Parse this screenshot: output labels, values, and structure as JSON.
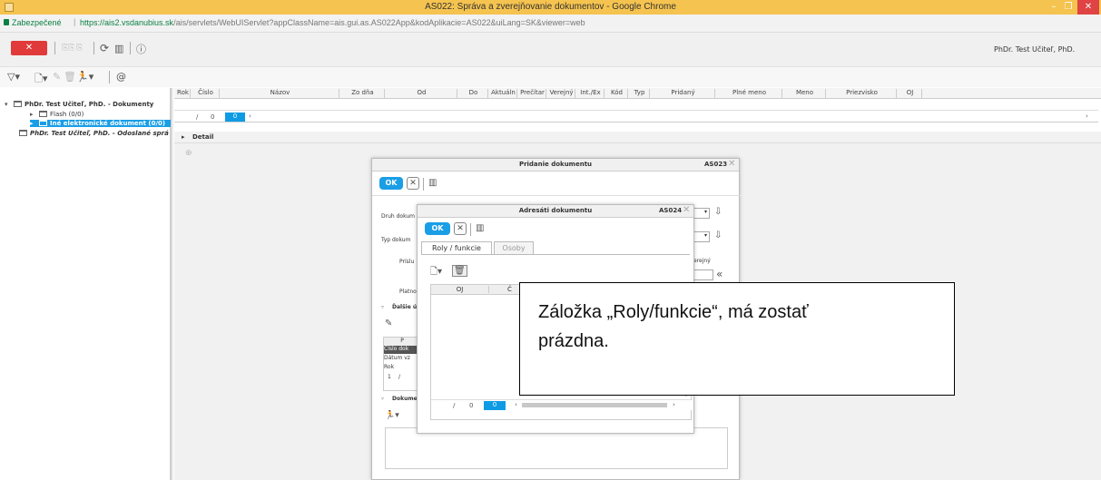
{
  "browser": {
    "window_title": "AS022: Správa a zverejňovanie dokumentov - Google Chrome",
    "secure_label": "Zabezpečené",
    "separator": "|",
    "url_host": "https://ais2.vsdanubius.sk",
    "url_path": "/ais/servlets/WebUIServlet?appClassName=ais.gui.as.AS022App&kodAplikacie=AS022&uiLang=SK&viewer=web",
    "minimize": "–",
    "maximize": "❐",
    "close": "✕"
  },
  "app_toolbar": {
    "close_label": "✕",
    "disabled_a": "⎘⎘",
    "disabled_b": "⎘",
    "refresh_icon": "⟳",
    "chart_icon": "▥",
    "info_icon": "ⓘ",
    "user": "PhDr. Test Učiteľ, PhD."
  },
  "toolbar2": {
    "filter_icon": "▽▾",
    "new_icon": "🗋▾",
    "edit_icon": "✎",
    "delete_icon": "🗑",
    "run_icon": "🏃▾",
    "at_icon": "@"
  },
  "tree": {
    "root": "PhDr. Test Učiteľ, PhD. - Dokumenty",
    "child_1": "Flash (0/0)",
    "child_2": "Iné elektronické dokument (0/0)",
    "sent": "PhDr. Test Učiteľ, PhD. - Odoslané sprá"
  },
  "grid": {
    "columns": [
      "Rok",
      "Číslo",
      "Názov",
      "Zo dňa",
      "Od",
      "Do",
      "Aktuáln",
      "Prečítar",
      "Verejný",
      "Int./Ex",
      "Kód",
      "Typ",
      "Pridaný",
      "Plné meno",
      "Meno",
      "Priezvisko",
      "OJ"
    ],
    "pager_slash": "/",
    "pager_count": "0",
    "pager_page": "0",
    "pager_left": "‹",
    "pager_right": "›"
  },
  "detail": {
    "label": "Detail",
    "zoom_icon": "⊕"
  },
  "dialog_add": {
    "title": "Pridanie dokumentu",
    "code": "AS023",
    "ok_label": "OK",
    "x_label": "✕",
    "chart_icon": "▥",
    "field_druh": "Druh dokum",
    "field_typ": "Typ dokum",
    "field_prislu": "Príslu",
    "field_platno": "Platno",
    "section_dalsie": "Ďalšie ú",
    "verejny": "erejný",
    "collapse": "«",
    "dropdown": "▾",
    "down_arrow": "⇩",
    "pencil": "✎",
    "sub_col": "P",
    "row_cislo": "Číslo dok",
    "row_datum": "Dátum vz",
    "row_rok": "Rok",
    "row_val": "1",
    "row_slash": "/",
    "section_dokume": "Dokume",
    "run_icon": "🏃▾",
    "tri": "▿"
  },
  "dialog_addr": {
    "title": "Adresáti dokumentu",
    "code": "AS024",
    "ok_label": "OK",
    "x_label": "✕",
    "chart_icon": "▥",
    "tab_roles": "Roly / funkcie",
    "tab_persons": "Osoby",
    "new_icon": "🗋▾",
    "delete_icon": "🗑",
    "col_oj": "OJ",
    "col_c": "Č",
    "pager_slash": "/",
    "pager_count": "0",
    "pager_page": "0",
    "pager_left": "‹",
    "pager_right": "›"
  },
  "annotation": {
    "line1": "Záložka „Roly/funkcie“, má zostať",
    "line2": "prázdna."
  },
  "colors": {
    "title_bar": "#f5c34f",
    "accent_blue": "#1a9ee6",
    "close_red": "#e03a3a"
  }
}
